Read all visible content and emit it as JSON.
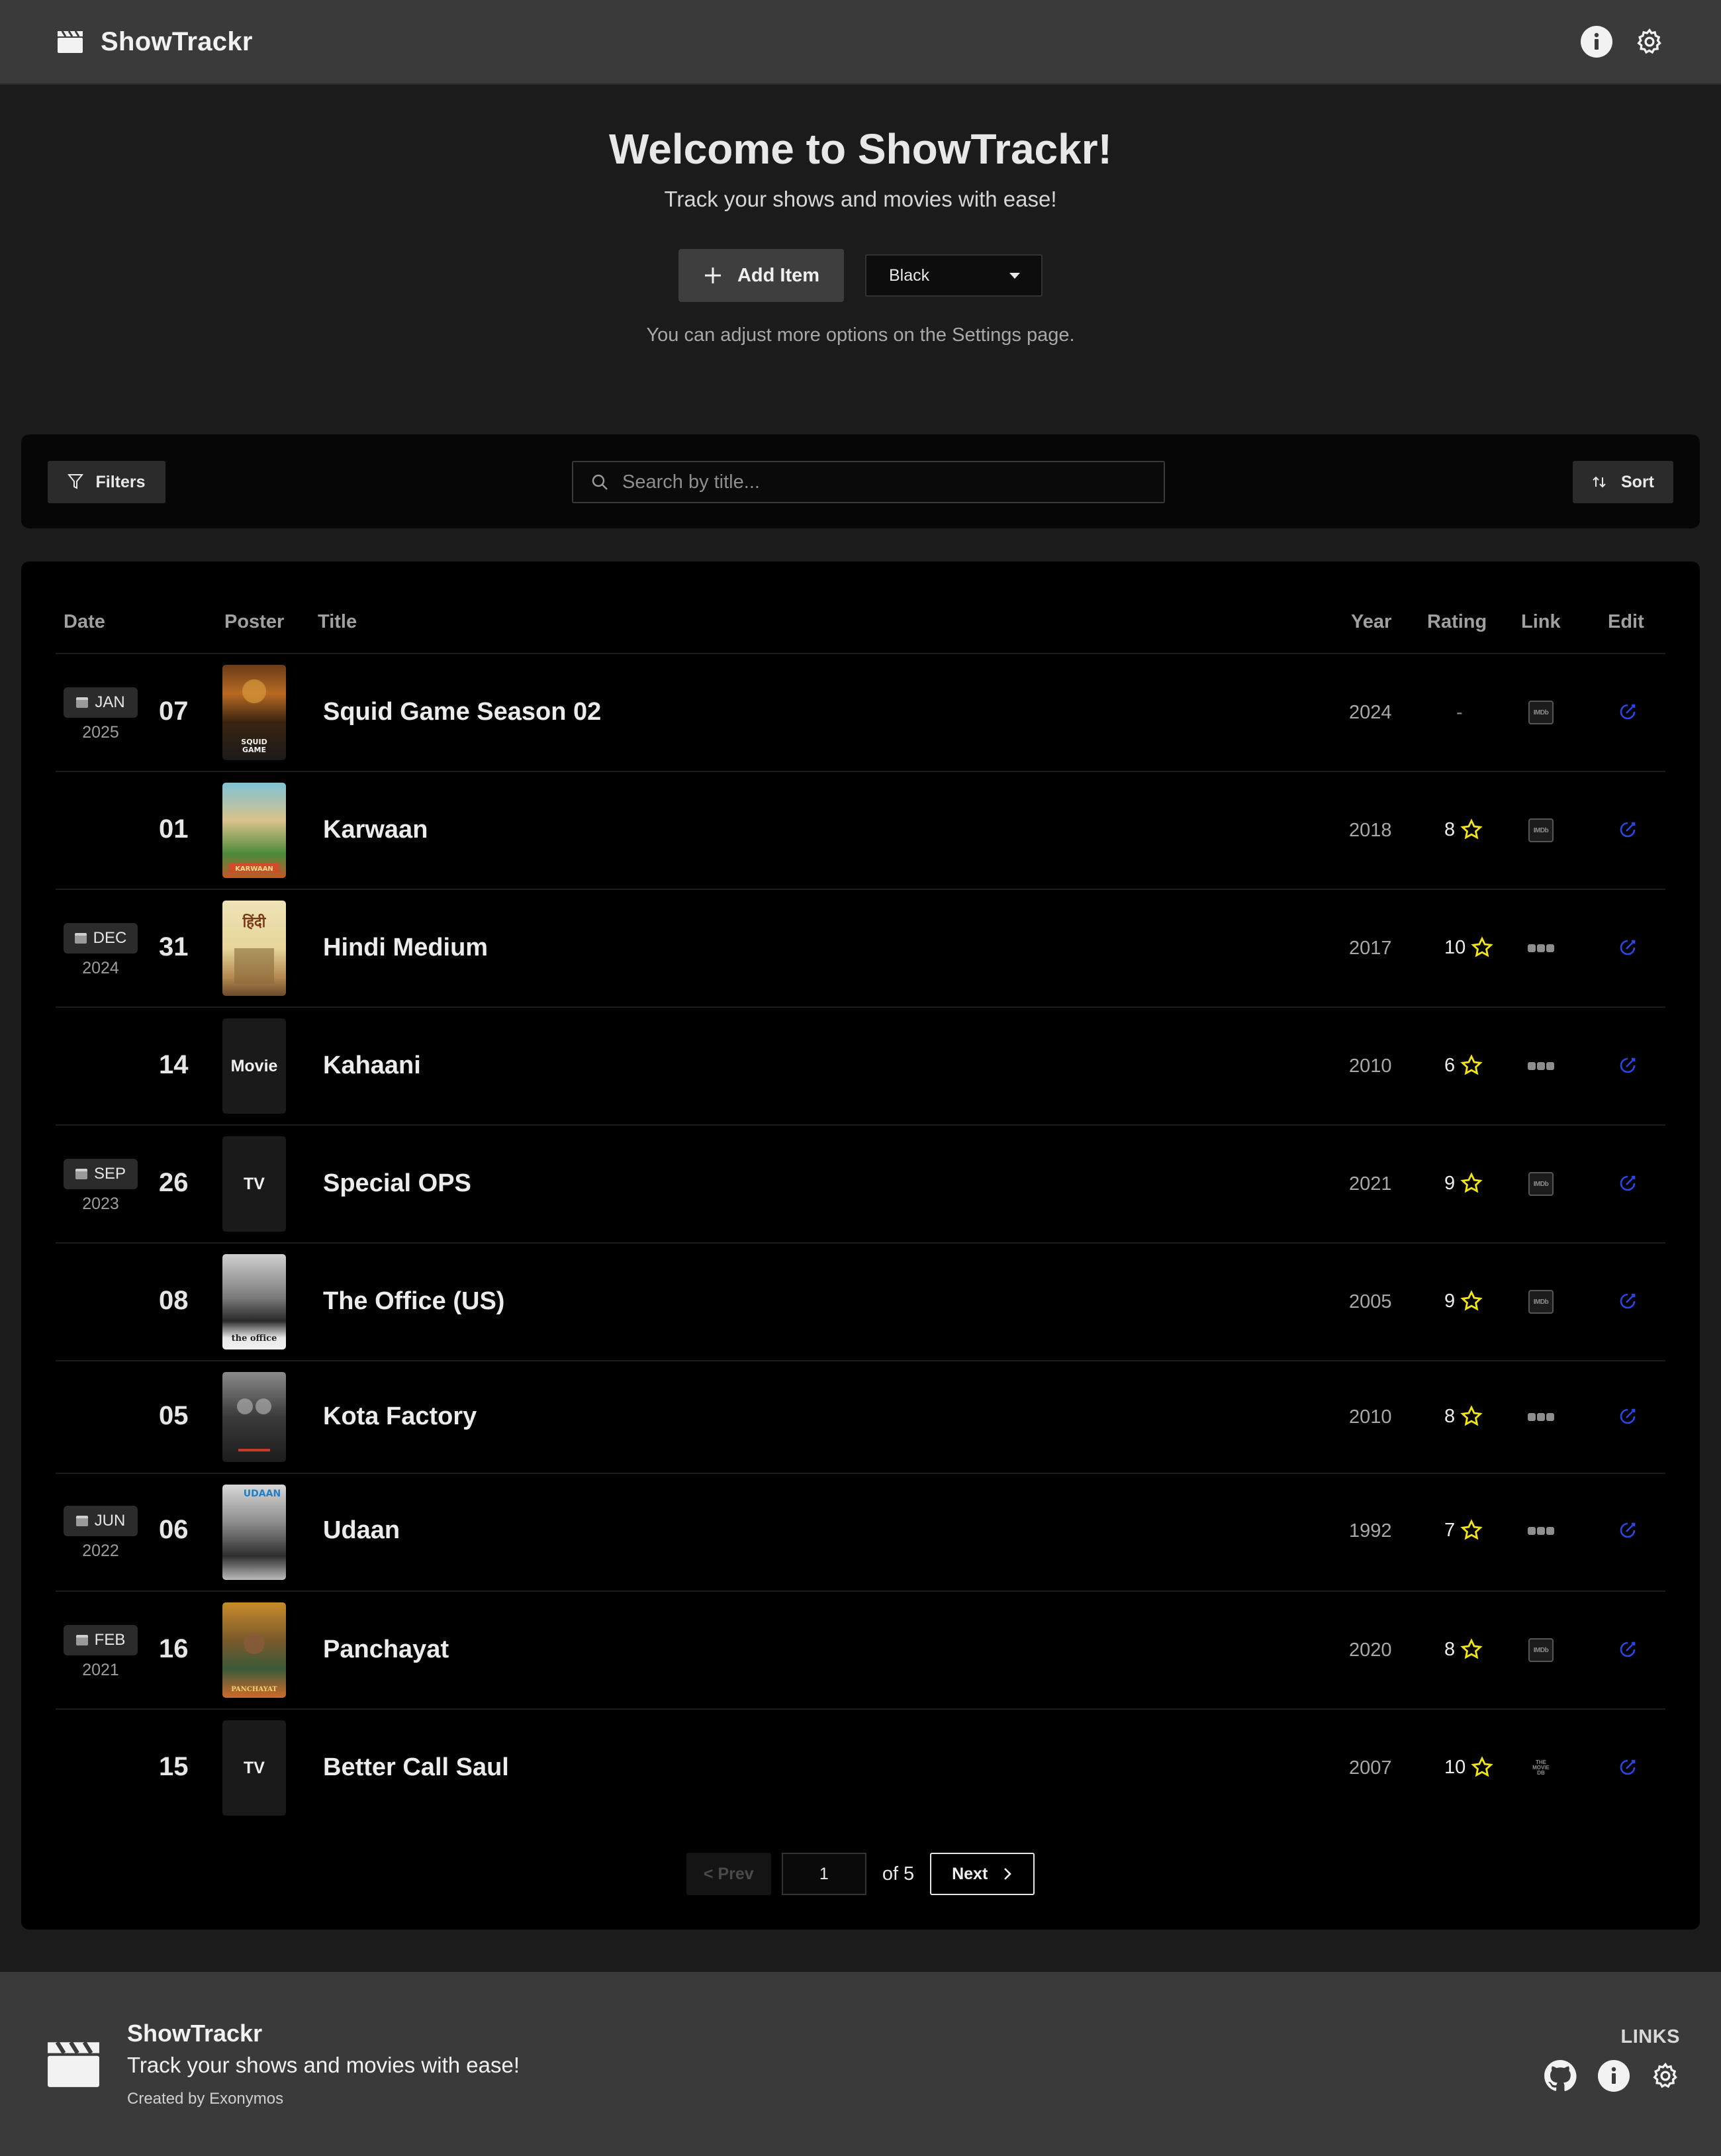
{
  "header": {
    "app_name": "ShowTrackr",
    "icons": [
      "clapperboard-icon",
      "info-icon",
      "gear-icon"
    ]
  },
  "hero": {
    "title": "Welcome to ShowTrackr!",
    "subtitle": "Track your shows and movies with ease!",
    "add_label": "Add Item",
    "theme_value": "Black",
    "note": "You can adjust more options on the Settings page."
  },
  "toolbar": {
    "filters_label": "Filters",
    "search_placeholder": "Search by title...",
    "sort_label": "Sort"
  },
  "table": {
    "columns": [
      "Date",
      "Poster",
      "Title",
      "Year",
      "Rating",
      "Link",
      "Edit"
    ],
    "rows": [
      {
        "month": "JAN",
        "year_group": "2025",
        "day": "07",
        "poster": "image",
        "title": "Squid Game Season 02",
        "year": "2024",
        "rating": "-",
        "link": "IMDb"
      },
      {
        "month": "",
        "year_group": "",
        "day": "01",
        "poster": "image",
        "title": "Karwaan",
        "year": "2018",
        "rating": "8",
        "link": "IMDb"
      },
      {
        "month": "DEC",
        "year_group": "2024",
        "day": "31",
        "poster": "image",
        "title": "Hindi Medium",
        "year": "2017",
        "rating": "10",
        "link": "other"
      },
      {
        "month": "",
        "year_group": "",
        "day": "14",
        "poster": "Movie",
        "title": "Kahaani",
        "year": "2010",
        "rating": "6",
        "link": "other"
      },
      {
        "month": "SEP",
        "year_group": "2023",
        "day": "26",
        "poster": "TV",
        "title": "Special OPS",
        "year": "2021",
        "rating": "9",
        "link": "IMDb"
      },
      {
        "month": "",
        "year_group": "",
        "day": "08",
        "poster": "image",
        "title": "The Office (US)",
        "year": "2005",
        "rating": "9",
        "link": "IMDb"
      },
      {
        "month": "",
        "year_group": "",
        "day": "05",
        "poster": "image",
        "title": "Kota Factory",
        "year": "2010",
        "rating": "8",
        "link": "other"
      },
      {
        "month": "JUN",
        "year_group": "2022",
        "day": "06",
        "poster": "image",
        "title": "Udaan",
        "year": "1992",
        "rating": "7",
        "link": "other"
      },
      {
        "month": "FEB",
        "year_group": "2021",
        "day": "16",
        "poster": "image",
        "title": "Panchayat",
        "year": "2020",
        "rating": "8",
        "link": "IMDb"
      },
      {
        "month": "",
        "year_group": "",
        "day": "15",
        "poster": "TV",
        "title": "Better Call Saul",
        "year": "2007",
        "rating": "10",
        "link": "TMDB"
      }
    ]
  },
  "pagination": {
    "prev_label": "< Prev",
    "current_page": "1",
    "of_label": "of 5",
    "next_label": "Next"
  },
  "footer": {
    "app_name": "ShowTrackr",
    "tagline": "Track your shows and movies with ease!",
    "credit": "Created by Exonymos",
    "links_title": "LINKS"
  },
  "colors": {
    "header_bg": "#3a3a3a",
    "page_bg": "#1b1b1b",
    "panel_bg": "#000000",
    "star": "#f5e50f",
    "edit_icon": "#2b46e8"
  }
}
